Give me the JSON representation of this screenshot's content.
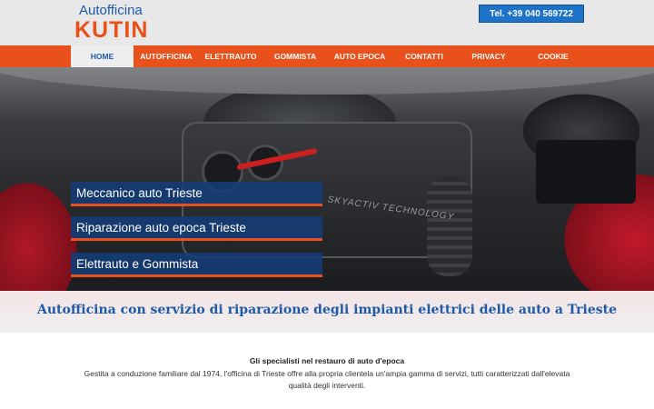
{
  "header": {
    "logo_top": "Autofficina",
    "logo_main": "KUTIN",
    "phone_label": "Tel. +39 040 569722"
  },
  "nav": {
    "items": [
      {
        "label": "HOME",
        "active": true
      },
      {
        "label": "AUTOFFICINA"
      },
      {
        "label": "ELETTRAUTO"
      },
      {
        "label": "GOMMISTA"
      },
      {
        "label": "AUTO EPOCA"
      },
      {
        "label": "CONTATTI"
      },
      {
        "label": "PRIVACY"
      },
      {
        "label": "COOKIE"
      }
    ]
  },
  "hero": {
    "engine_text": "SKYACTIV TECHNOLOGY",
    "labels": [
      "Meccanico auto Trieste",
      "Riparazione auto epoca Trieste",
      "Elettrauto e Gommista"
    ]
  },
  "tagline": "Autofficina con servizio di riparazione degli impianti elettrici delle auto a Trieste",
  "content": {
    "title": "Gli specialisti nel restauro di auto d'epoca",
    "text": "Gestita a conduzione familiare dal 1974, l'officina di Trieste offre alla propria clientela un'ampia gamma di servizi, tutti caratterizzati dall'elevata qualità degli interventi."
  },
  "colors": {
    "brand_orange": "#e8501c",
    "brand_blue": "#1e5aa8",
    "phone_button": "#1e73c8"
  }
}
